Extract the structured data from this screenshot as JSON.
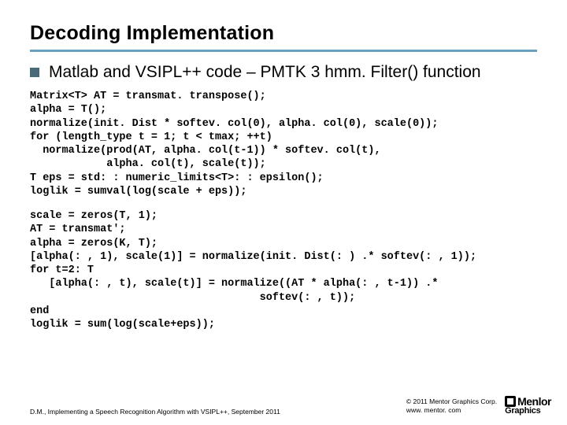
{
  "title": "Decoding Implementation",
  "subtitle": "Matlab and VSIPL++ code – PMTK 3 hmm. Filter() function",
  "code1": "Matrix<T> AT = transmat. transpose();\nalpha = T();\nnormalize(init. Dist * softev. col(0), alpha. col(0), scale(0));\nfor (length_type t = 1; t < tmax; ++t)\n  normalize(prod(AT, alpha. col(t-1)) * softev. col(t),\n            alpha. col(t), scale(t));\nT eps = std: : numeric_limits<T>: : epsilon();\nloglik = sumval(log(scale + eps));",
  "code2": "scale = zeros(T, 1);\nAT = transmat';\nalpha = zeros(K, T);\n[alpha(: , 1), scale(1)] = normalize(init. Dist(: ) .* softev(: , 1));\nfor t=2: T\n   [alpha(: , t), scale(t)] = normalize((AT * alpha(: , t-1)) .*\n                                    softev(: , t));\nend\nloglik = sum(log(scale+eps));",
  "footer_left": "D.M., Implementing a Speech Recognition Algorithm with VSIPL++, September 2011",
  "copyright_line1": "© 2011 Mentor Graphics Corp.",
  "copyright_line2": "www. mentor. com",
  "logo_top": "Menlor",
  "logo_bot": "Graphics"
}
